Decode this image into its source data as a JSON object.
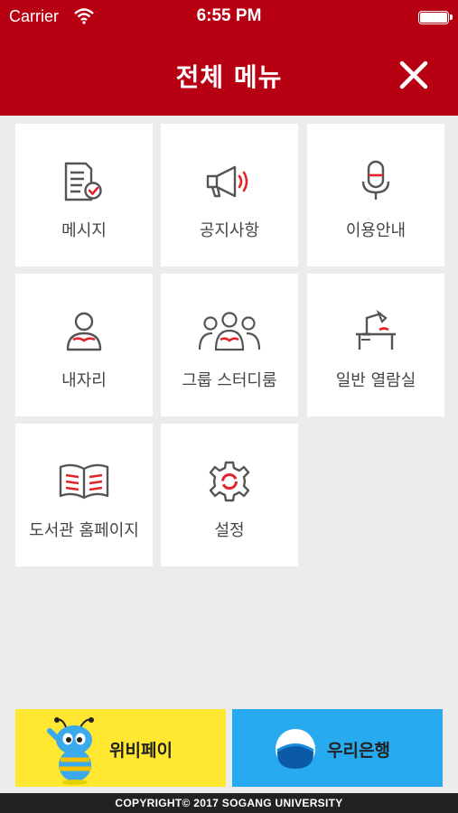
{
  "status_bar": {
    "carrier": "Carrier",
    "time": "6:55 PM"
  },
  "header": {
    "title": "전체 메뉴"
  },
  "menu": {
    "items": [
      {
        "label": "메시지",
        "icon": "message-document-icon"
      },
      {
        "label": "공지사항",
        "icon": "megaphone-icon"
      },
      {
        "label": "이용안내",
        "icon": "microphone-icon"
      },
      {
        "label": "내자리",
        "icon": "person-reading-icon"
      },
      {
        "label": "그룹 스터디룸",
        "icon": "group-reading-icon"
      },
      {
        "label": "일반 열람실",
        "icon": "study-desk-icon"
      },
      {
        "label": "도서관 홈페이지",
        "icon": "open-book-icon"
      },
      {
        "label": "설정",
        "icon": "gear-icon"
      }
    ]
  },
  "bottom_buttons": {
    "wibee_pay": {
      "label": "위비페이",
      "icon": "wibee-mascot-icon",
      "color": "#ffe732"
    },
    "woori_bank": {
      "label": "우리은행",
      "icon": "woori-bank-logo-icon",
      "color": "#27aaf0"
    }
  },
  "footer": {
    "copyright": "COPYRIGHT© 2017 SOGANG UNIVERSITY"
  },
  "colors": {
    "brand_red": "#b70012",
    "accent_red": "#e0242c",
    "icon_gray": "#555555",
    "background": "#ececec"
  }
}
